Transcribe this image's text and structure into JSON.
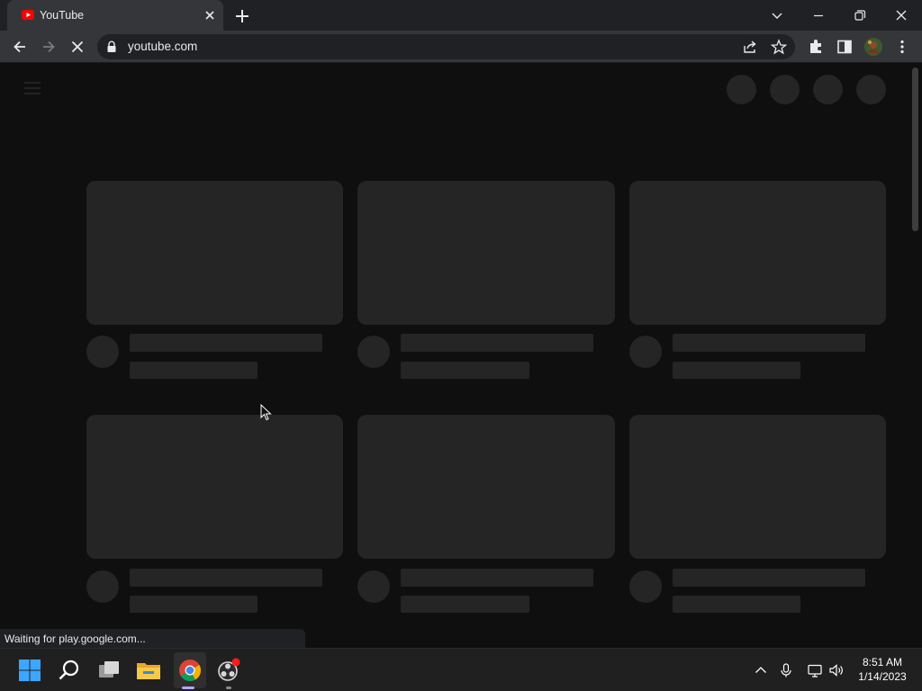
{
  "tab": {
    "title": "YouTube"
  },
  "omnibox": {
    "url": "youtube.com"
  },
  "status_text": "Waiting for play.google.com...",
  "clock": {
    "time": "8:51 AM",
    "date": "1/14/2023"
  },
  "colors": {
    "youtube_red": "#ff0000",
    "skeleton": "#252525",
    "page_bg": "#0f0f0f"
  }
}
